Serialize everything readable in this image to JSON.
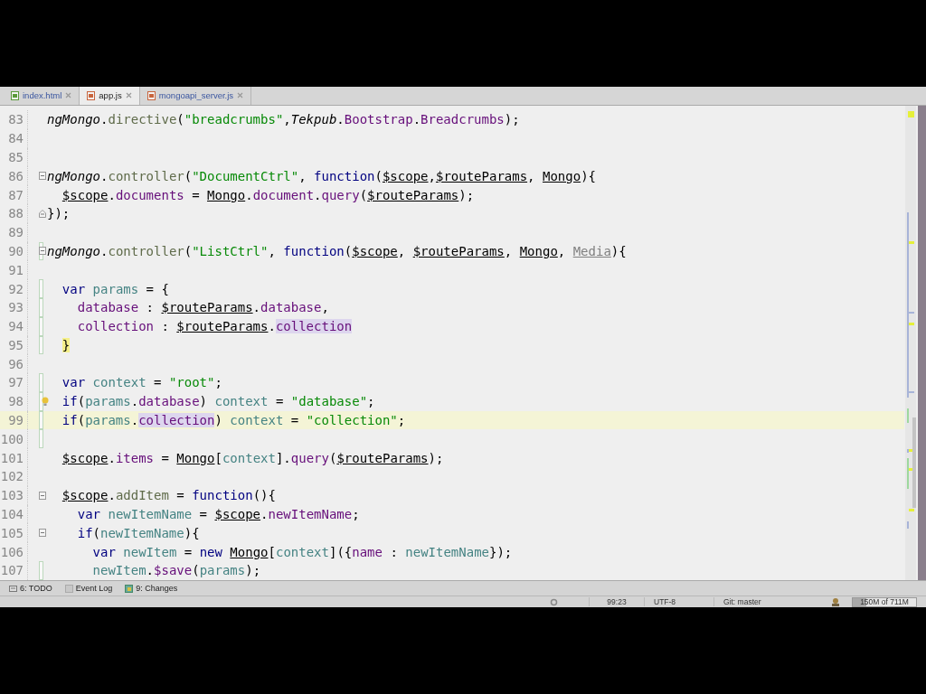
{
  "tabs": [
    {
      "label": "index.html",
      "kind": "html",
      "selected": false
    },
    {
      "label": "app.js",
      "kind": "js",
      "selected": true
    },
    {
      "label": "mongoapi_server.js",
      "kind": "js",
      "selected": false
    }
  ],
  "editor": {
    "lines": [
      {
        "number": "83",
        "changed": false,
        "current": false,
        "bulb": false,
        "tokens": [
          {
            "kind": "global",
            "text": "ngMongo"
          },
          {
            "kind": "plain",
            "text": "."
          },
          {
            "kind": "method",
            "text": "directive"
          },
          {
            "kind": "plain",
            "text": "("
          },
          {
            "kind": "string",
            "text": "\"breadcrumbs\""
          },
          {
            "kind": "plain",
            "text": ","
          },
          {
            "kind": "global",
            "text": "Tekpub"
          },
          {
            "kind": "plain",
            "text": "."
          },
          {
            "kind": "field",
            "text": "Bootstrap"
          },
          {
            "kind": "plain",
            "text": "."
          },
          {
            "kind": "field",
            "text": "Breadcrumbs"
          },
          {
            "kind": "plain",
            "text": ");"
          }
        ]
      },
      {
        "number": "84",
        "changed": false,
        "current": false,
        "bulb": false
      },
      {
        "number": "85",
        "changed": false,
        "current": false,
        "bulb": false
      },
      {
        "number": "86",
        "fold_start": true,
        "changed": false,
        "current": false,
        "bulb": false,
        "tokens": [
          {
            "kind": "global",
            "text": "ngMongo"
          },
          {
            "kind": "plain",
            "text": "."
          },
          {
            "kind": "method",
            "text": "controller"
          },
          {
            "kind": "plain",
            "text": "("
          },
          {
            "kind": "string",
            "text": "\"DocumentCtrl\""
          },
          {
            "kind": "plain",
            "text": ", "
          },
          {
            "kind": "keyword",
            "text": "function"
          },
          {
            "kind": "plain",
            "text": "("
          },
          {
            "kind": "param",
            "text": "$scope"
          },
          {
            "kind": "plain",
            "text": ","
          },
          {
            "kind": "param",
            "text": "$routeParams"
          },
          {
            "kind": "plain",
            "text": ", "
          },
          {
            "kind": "param",
            "text": "Mongo"
          },
          {
            "kind": "plain",
            "text": "){"
          }
        ]
      },
      {
        "number": "87",
        "changed": false,
        "current": false,
        "bulb": false,
        "tokens": [
          {
            "kind": "param",
            "text": "  $scope"
          },
          {
            "kind": "plain",
            "text": "."
          },
          {
            "kind": "field",
            "text": "documents"
          },
          {
            "kind": "plain",
            "text": " = "
          },
          {
            "kind": "param",
            "text": "Mongo"
          },
          {
            "kind": "plain",
            "text": "."
          },
          {
            "kind": "field",
            "text": "document"
          },
          {
            "kind": "plain",
            "text": "."
          },
          {
            "kind": "field",
            "text": "query"
          },
          {
            "kind": "plain",
            "text": "("
          },
          {
            "kind": "param",
            "text": "$routeParams"
          },
          {
            "kind": "plain",
            "text": ");"
          }
        ]
      },
      {
        "number": "88",
        "fold_end": true,
        "changed": false,
        "current": false,
        "bulb": false,
        "tokens": [
          {
            "kind": "plain",
            "text": "});"
          }
        ]
      },
      {
        "number": "89",
        "changed": false,
        "current": false,
        "bulb": false
      },
      {
        "number": "90",
        "fold_start": true,
        "changed": true,
        "current": false,
        "bulb": false,
        "tokens": [
          {
            "kind": "global",
            "text": "ngMongo"
          },
          {
            "kind": "plain",
            "text": "."
          },
          {
            "kind": "method",
            "text": "controller"
          },
          {
            "kind": "plain",
            "text": "("
          },
          {
            "kind": "string",
            "text": "\"ListCtrl\""
          },
          {
            "kind": "plain",
            "text": ", "
          },
          {
            "kind": "keyword",
            "text": "function"
          },
          {
            "kind": "plain",
            "text": "("
          },
          {
            "kind": "param",
            "text": "$scope"
          },
          {
            "kind": "plain",
            "text": ", "
          },
          {
            "kind": "param",
            "text": "$routeParams"
          },
          {
            "kind": "plain",
            "text": ", "
          },
          {
            "kind": "param",
            "text": "Mongo"
          },
          {
            "kind": "plain",
            "text": ", "
          },
          {
            "kind": "unused",
            "text": "Media"
          },
          {
            "kind": "plain",
            "text": "){"
          }
        ]
      },
      {
        "number": "91",
        "changed": false,
        "current": false,
        "bulb": false
      },
      {
        "number": "92",
        "changed": true,
        "current": false,
        "bulb": false,
        "tokens": [
          {
            "kind": "keyword",
            "text": "  var"
          },
          {
            "kind": "local",
            "text": " params"
          },
          {
            "kind": "plain",
            "text": " = {"
          }
        ]
      },
      {
        "number": "93",
        "changed": true,
        "current": false,
        "bulb": false,
        "tokens": [
          {
            "kind": "field",
            "text": "    database"
          },
          {
            "kind": "plain",
            "text": " : "
          },
          {
            "kind": "param",
            "text": "$routeParams"
          },
          {
            "kind": "plain",
            "text": "."
          },
          {
            "kind": "field",
            "text": "database"
          },
          {
            "kind": "plain",
            "text": ","
          }
        ]
      },
      {
        "number": "94",
        "changed": true,
        "current": false,
        "bulb": false,
        "tokens": [
          {
            "kind": "field",
            "text": "    collection"
          },
          {
            "kind": "plain",
            "text": " : "
          },
          {
            "kind": "param",
            "text": "$routeParams"
          },
          {
            "kind": "plain",
            "text": "."
          },
          {
            "kind": "match",
            "text": "collection"
          }
        ]
      },
      {
        "number": "95",
        "changed": true,
        "current": false,
        "bulb": false,
        "tokens": [
          {
            "kind": "brace",
            "text": "  }"
          }
        ]
      },
      {
        "number": "96",
        "changed": false,
        "current": false,
        "bulb": false
      },
      {
        "number": "97",
        "changed": true,
        "current": false,
        "bulb": false,
        "tokens": [
          {
            "kind": "keyword",
            "text": "  var"
          },
          {
            "kind": "local",
            "text": " context"
          },
          {
            "kind": "plain",
            "text": " = "
          },
          {
            "kind": "string",
            "text": "\"root\""
          },
          {
            "kind": "plain",
            "text": ";"
          }
        ]
      },
      {
        "number": "98",
        "changed": true,
        "current": false,
        "bulb": true,
        "tokens": [
          {
            "kind": "keyword",
            "text": "  if"
          },
          {
            "kind": "plain",
            "text": "("
          },
          {
            "kind": "local",
            "text": "params"
          },
          {
            "kind": "plain",
            "text": "."
          },
          {
            "kind": "field",
            "text": "database"
          },
          {
            "kind": "plain",
            "text": ") "
          },
          {
            "kind": "local",
            "text": "context"
          },
          {
            "kind": "plain",
            "text": " = "
          },
          {
            "kind": "string",
            "text": "\"database\""
          },
          {
            "kind": "plain",
            "text": ";"
          }
        ]
      },
      {
        "number": "99",
        "changed": true,
        "current": true,
        "bulb": false,
        "tokens": [
          {
            "kind": "keyword",
            "text": "  if"
          },
          {
            "kind": "plain",
            "text": "("
          },
          {
            "kind": "local",
            "text": "params"
          },
          {
            "kind": "plain",
            "text": "."
          },
          {
            "kind": "match",
            "text": "collection"
          },
          {
            "kind": "plain",
            "text": ") "
          },
          {
            "kind": "local",
            "text": "context"
          },
          {
            "kind": "plain",
            "text": " = "
          },
          {
            "kind": "string",
            "text": "\"collection\""
          },
          {
            "kind": "plain",
            "text": ";"
          }
        ]
      },
      {
        "number": "100",
        "changed": true,
        "current": false,
        "bulb": false
      },
      {
        "number": "101",
        "changed": false,
        "current": false,
        "bulb": false,
        "tokens": [
          {
            "kind": "param",
            "text": "  $scope"
          },
          {
            "kind": "plain",
            "text": "."
          },
          {
            "kind": "field",
            "text": "items"
          },
          {
            "kind": "plain",
            "text": " = "
          },
          {
            "kind": "param",
            "text": "Mongo"
          },
          {
            "kind": "plain",
            "text": "["
          },
          {
            "kind": "local",
            "text": "context"
          },
          {
            "kind": "plain",
            "text": "]."
          },
          {
            "kind": "field",
            "text": "query"
          },
          {
            "kind": "plain",
            "text": "("
          },
          {
            "kind": "param",
            "text": "$routeParams"
          },
          {
            "kind": "plain",
            "text": ");"
          }
        ]
      },
      {
        "number": "102",
        "changed": false,
        "current": false,
        "bulb": false
      },
      {
        "number": "103",
        "fold_start": true,
        "changed": false,
        "current": false,
        "bulb": false,
        "tokens": [
          {
            "kind": "param",
            "text": "  $scope"
          },
          {
            "kind": "plain",
            "text": "."
          },
          {
            "kind": "method",
            "text": "addItem"
          },
          {
            "kind": "plain",
            "text": " = "
          },
          {
            "kind": "keyword",
            "text": "function"
          },
          {
            "kind": "plain",
            "text": "(){"
          }
        ]
      },
      {
        "number": "104",
        "changed": false,
        "current": false,
        "bulb": false,
        "tokens": [
          {
            "kind": "keyword",
            "text": "    var"
          },
          {
            "kind": "local",
            "text": " newItemName"
          },
          {
            "kind": "plain",
            "text": " = "
          },
          {
            "kind": "param",
            "text": "$scope"
          },
          {
            "kind": "plain",
            "text": "."
          },
          {
            "kind": "field",
            "text": "newItemName"
          },
          {
            "kind": "plain",
            "text": ";"
          }
        ]
      },
      {
        "number": "105",
        "fold_start": true,
        "changed": false,
        "current": false,
        "bulb": false,
        "tokens": [
          {
            "kind": "keyword",
            "text": "    if"
          },
          {
            "kind": "plain",
            "text": "("
          },
          {
            "kind": "local",
            "text": "newItemName"
          },
          {
            "kind": "plain",
            "text": "){"
          }
        ]
      },
      {
        "number": "106",
        "changed": false,
        "current": false,
        "bulb": false,
        "tokens": [
          {
            "kind": "keyword",
            "text": "      var"
          },
          {
            "kind": "local",
            "text": " newItem"
          },
          {
            "kind": "plain",
            "text": " = "
          },
          {
            "kind": "keyword",
            "text": "new"
          },
          {
            "kind": "param",
            "text": " Mongo"
          },
          {
            "kind": "plain",
            "text": "["
          },
          {
            "kind": "local",
            "text": "context"
          },
          {
            "kind": "plain",
            "text": "]({"
          },
          {
            "kind": "field",
            "text": "name"
          },
          {
            "kind": "plain",
            "text": " : "
          },
          {
            "kind": "local",
            "text": "newItemName"
          },
          {
            "kind": "plain",
            "text": "});"
          }
        ]
      },
      {
        "number": "107",
        "changed": true,
        "current": false,
        "bulb": false,
        "tokens": [
          {
            "kind": "local",
            "text": "      newItem"
          },
          {
            "kind": "plain",
            "text": "."
          },
          {
            "kind": "field",
            "text": "$save"
          },
          {
            "kind": "plain",
            "text": "("
          },
          {
            "kind": "local",
            "text": "params"
          },
          {
            "kind": "plain",
            "text": ");"
          }
        ]
      }
    ]
  },
  "tool_windows": [
    {
      "label": "6: TODO",
      "kind": "todo"
    },
    {
      "label": "Event Log",
      "kind": "log"
    },
    {
      "label": "9: Changes",
      "kind": "changes"
    }
  ],
  "status_bar": {
    "position": "99:23",
    "encoding": "UTF-8",
    "vcs": "Git: master",
    "memory": {
      "text": "150M of 711M",
      "level": 0.21
    }
  }
}
